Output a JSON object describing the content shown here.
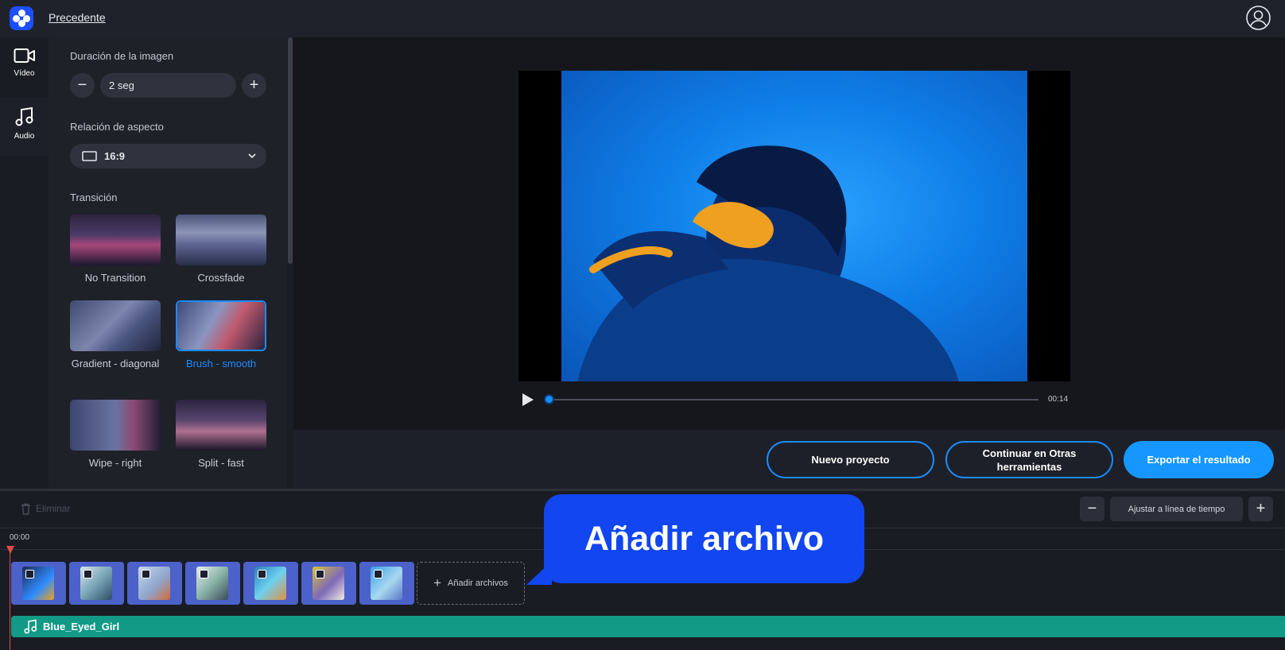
{
  "header": {
    "back_link": "Precedente",
    "logo_icon": "app-logo-icon",
    "user_icon": "user-avatar-icon"
  },
  "rail": {
    "items": [
      {
        "label": "Vídeo",
        "icon": "video-camera-icon"
      },
      {
        "label": "Audio",
        "icon": "music-note-icon"
      }
    ]
  },
  "settings": {
    "duration_label": "Duración de la imagen",
    "duration_value": "2 seg",
    "aspect_label": "Relación de aspecto",
    "aspect_value": "16:9",
    "transition_label": "Transición",
    "transitions": [
      {
        "label": "No Transition",
        "selected": false
      },
      {
        "label": "Crossfade",
        "selected": false
      },
      {
        "label": "Gradient - diagonal",
        "selected": false
      },
      {
        "label": "Brush - smooth",
        "selected": true
      },
      {
        "label": "Wipe - right",
        "selected": false
      },
      {
        "label": "Split - fast",
        "selected": false
      }
    ]
  },
  "player": {
    "time": "00:14",
    "progress": 0.0
  },
  "actions": {
    "new_project": "Nuevo proyecto",
    "continue_tools": "Continuar en Otras herramientas",
    "export": "Exportar el resultado"
  },
  "timeline": {
    "delete_label": "Eliminar",
    "fit_label": "Ajustar a línea de tiempo",
    "start_time": "00:00",
    "add_files_label": "Añadir archivos",
    "clip_count": 7,
    "audio_track_name": "Blue_Eyed_Girl"
  },
  "callout": {
    "text": "Añadir archivo"
  },
  "colors": {
    "accent": "#1a8cff",
    "callout": "#1146f0",
    "audio_track": "#129a86",
    "clip": "#4c61c9",
    "playhead": "#e34a4a"
  }
}
